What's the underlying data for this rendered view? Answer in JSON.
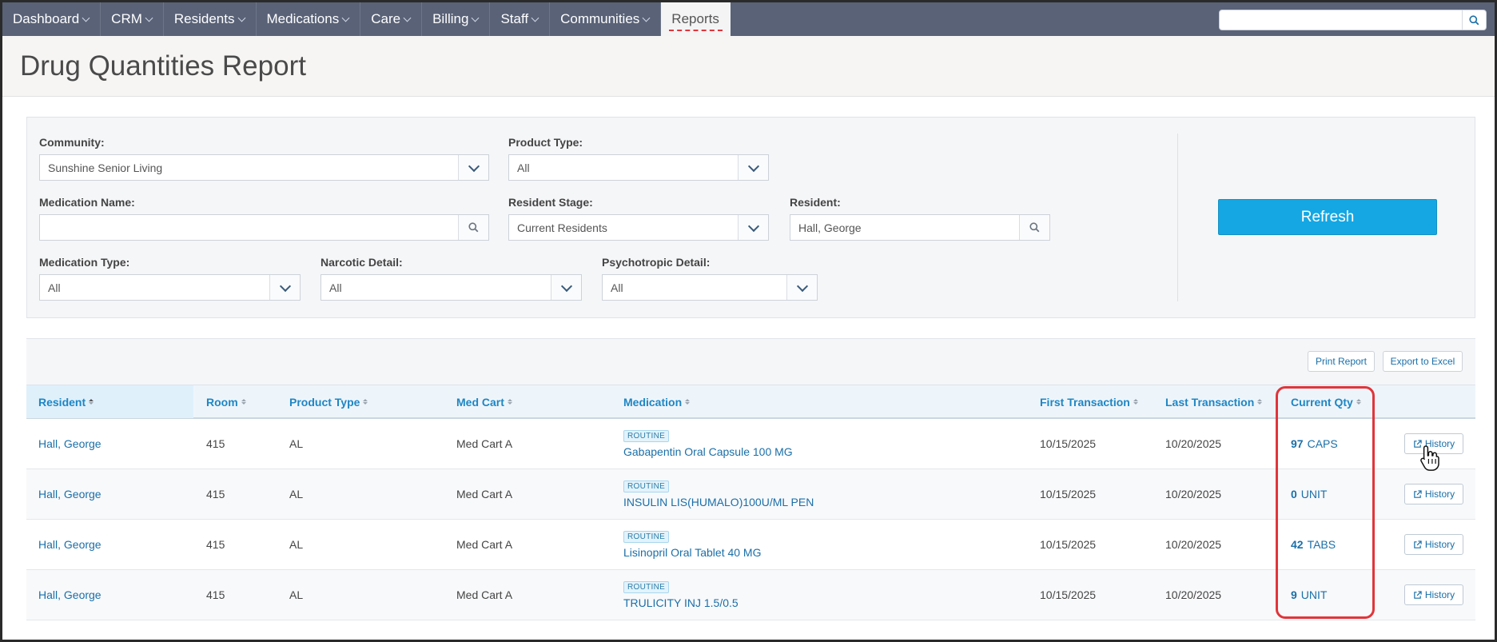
{
  "nav": {
    "items": [
      {
        "label": "Dashboard"
      },
      {
        "label": "CRM"
      },
      {
        "label": "Residents"
      },
      {
        "label": "Medications"
      },
      {
        "label": "Care"
      },
      {
        "label": "Billing"
      },
      {
        "label": "Staff"
      },
      {
        "label": "Communities"
      }
    ],
    "active": "Reports",
    "search_placeholder": ""
  },
  "page": {
    "title": "Drug Quantities Report"
  },
  "filters": {
    "community": {
      "label": "Community:",
      "value": "Sunshine Senior Living"
    },
    "product_type": {
      "label": "Product Type:",
      "value": "All"
    },
    "medication_name": {
      "label": "Medication Name:",
      "value": ""
    },
    "resident_stage": {
      "label": "Resident Stage:",
      "value": "Current Residents"
    },
    "resident": {
      "label": "Resident:",
      "value": "Hall, George"
    },
    "medication_type": {
      "label": "Medication Type:",
      "value": "All"
    },
    "narcotic_detail": {
      "label": "Narcotic Detail:",
      "value": "All"
    },
    "psychotropic_detail": {
      "label": "Psychotropic Detail:",
      "value": "All"
    },
    "refresh_label": "Refresh"
  },
  "toolbar": {
    "print_label": "Print Report",
    "export_label": "Export to Excel"
  },
  "table": {
    "columns": {
      "resident": "Resident",
      "room": "Room",
      "product_type": "Product Type",
      "med_cart": "Med Cart",
      "medication": "Medication",
      "first_transaction": "First Transaction",
      "last_transaction": "Last Transaction",
      "current_qty": "Current Qty"
    },
    "history_label": "History",
    "rows": [
      {
        "resident": "Hall, George",
        "room": "415",
        "product_type": "AL",
        "med_cart": "Med Cart A",
        "badge": "ROUTINE",
        "medication": "Gabapentin Oral Capsule 100 MG",
        "first": "10/15/2025",
        "last": "10/20/2025",
        "qty": "97",
        "unit": "CAPS"
      },
      {
        "resident": "Hall, George",
        "room": "415",
        "product_type": "AL",
        "med_cart": "Med Cart A",
        "badge": "ROUTINE",
        "medication": "INSULIN LIS(HUMALO)100U/ML PEN",
        "first": "10/15/2025",
        "last": "10/20/2025",
        "qty": "0",
        "unit": "UNIT"
      },
      {
        "resident": "Hall, George",
        "room": "415",
        "product_type": "AL",
        "med_cart": "Med Cart A",
        "badge": "ROUTINE",
        "medication": "Lisinopril Oral Tablet 40 MG",
        "first": "10/15/2025",
        "last": "10/20/2025",
        "qty": "42",
        "unit": "TABS"
      },
      {
        "resident": "Hall, George",
        "room": "415",
        "product_type": "AL",
        "med_cart": "Med Cart A",
        "badge": "ROUTINE",
        "medication": "TRULICITY INJ 1.5/0.5",
        "first": "10/15/2025",
        "last": "10/20/2025",
        "qty": "9",
        "unit": "UNIT"
      }
    ]
  },
  "colors": {
    "nav_bg": "#596277",
    "accent": "#14a7e3",
    "link": "#1a6fa8",
    "highlight": "#e0353a"
  }
}
